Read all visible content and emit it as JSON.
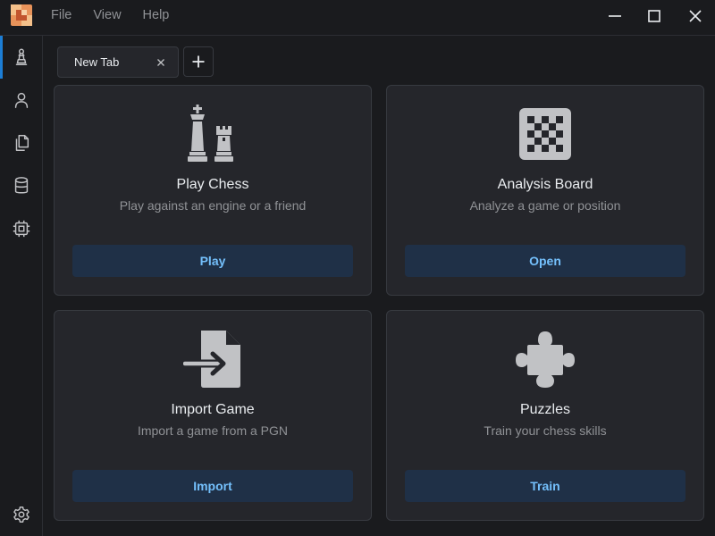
{
  "menu": {
    "file": "File",
    "view": "View",
    "help": "Help"
  },
  "tabs": [
    {
      "label": "New Tab"
    }
  ],
  "sidebar": {
    "items": [
      {
        "icon": "chess-pawn-icon",
        "active": true
      },
      {
        "icon": "user-icon",
        "active": false
      },
      {
        "icon": "files-icon",
        "active": false
      },
      {
        "icon": "database-icon",
        "active": false
      },
      {
        "icon": "cpu-icon",
        "active": false
      }
    ],
    "bottom_icon": "settings-icon"
  },
  "cards": [
    {
      "icon": "chess-king-rook-icon",
      "title": "Play Chess",
      "description": "Play against an engine or a friend",
      "button": "Play"
    },
    {
      "icon": "chessboard-icon",
      "title": "Analysis Board",
      "description": "Analyze a game or position",
      "button": "Open"
    },
    {
      "icon": "file-import-icon",
      "title": "Import Game",
      "description": "Import a game from a PGN",
      "button": "Import"
    },
    {
      "icon": "puzzle-icon",
      "title": "Puzzles",
      "description": "Train your chess skills",
      "button": "Train"
    }
  ],
  "colors": {
    "background": "#1a1b1e",
    "card": "#25262b",
    "border": "#373a40",
    "accent": "#1c7ed6",
    "button_bg": "#1f3047",
    "button_text": "#74c0fc"
  }
}
